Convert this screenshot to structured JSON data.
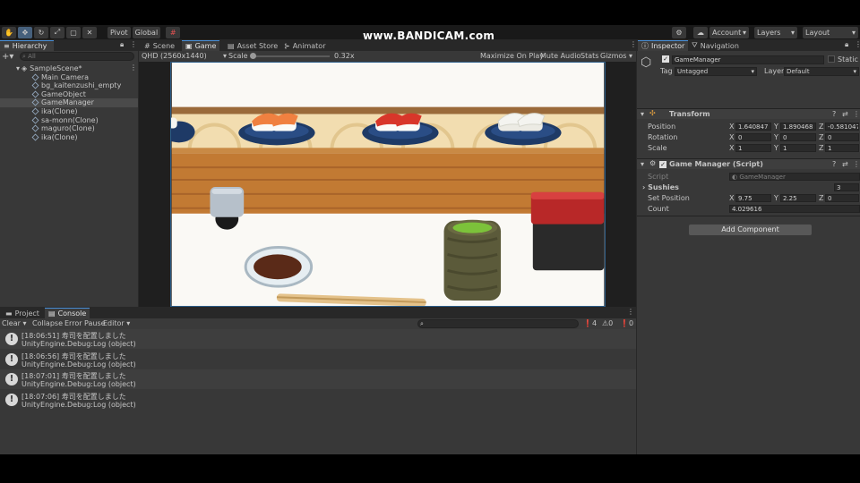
{
  "watermark": "www.BANDICAM.com",
  "toolbar": {
    "tools": [
      "hand-icon",
      "move-icon",
      "rotate-icon",
      "scale-icon",
      "rect-icon",
      "transform-icon"
    ],
    "pivot": "Pivot",
    "global": "Global",
    "account": "Account",
    "layers": "Layers",
    "layout": "Layout"
  },
  "hierarchy": {
    "tab": "Hierarchy",
    "search_placeholder": "All",
    "scene": "SampleScene*",
    "items": [
      "Main Camera",
      "bg_kaitenzushi_empty",
      "GameObject",
      "GameManager",
      "ika(Clone)",
      "sa-monn(Clone)",
      "maguro(Clone)",
      "ika(Clone)"
    ],
    "selected_index": 3
  },
  "center_tabs": {
    "scene": "Scene",
    "game": "Game",
    "asset_store": "Asset Store",
    "animator": "Animator"
  },
  "game_bar": {
    "resolution": "QHD (2560x1440)",
    "scale_label": "Scale",
    "scale_value": "0.32x",
    "maximize": "Maximize On Play",
    "mute": "Mute Audio",
    "stats": "Stats",
    "gizmos": "Gizmos"
  },
  "inspector": {
    "tab": "Inspector",
    "nav_tab": "Navigation",
    "object_name": "GameManager",
    "static": "Static",
    "tag_label": "Tag",
    "tag_value": "Untagged",
    "layer_label": "Layer",
    "layer_value": "Default",
    "transform": {
      "title": "Transform",
      "position_label": "Position",
      "position": [
        "1.640847",
        "1.890468",
        "-0.581047"
      ],
      "rotation_label": "Rotation",
      "rotation": [
        "0",
        "0",
        "0"
      ],
      "scale_label": "Scale",
      "scale": [
        "1",
        "1",
        "1"
      ]
    },
    "script_comp": {
      "title": "Game Manager (Script)",
      "script_label": "Script",
      "script_value": "GameManager",
      "sushies_label": "Sushies",
      "sushies_value": "3",
      "setpos_label": "Set Position",
      "setpos": [
        "9.75",
        "2.25",
        "0"
      ],
      "count_label": "Count",
      "count_value": "4.029616"
    },
    "add_component": "Add Component",
    "axes": [
      "X",
      "Y",
      "Z"
    ]
  },
  "bottom": {
    "project_tab": "Project",
    "console_tab": "Console",
    "clear": "Clear",
    "collapse": "Collapse",
    "error_pause": "Error Pause",
    "editor": "Editor",
    "counts": [
      "4",
      "0",
      "0"
    ],
    "logs": [
      {
        "time": "[18:06:51] 寿司を配置しました",
        "sub": "UnityEngine.Debug:Log (object)"
      },
      {
        "time": "[18:06:56] 寿司を配置しました",
        "sub": "UnityEngine.Debug:Log (object)"
      },
      {
        "time": "[18:07:01] 寿司を配置しました",
        "sub": "UnityEngine.Debug:Log (object)"
      },
      {
        "time": "[18:07:06] 寿司を配置しました",
        "sub": "UnityEngine.Debug:Log (object)"
      }
    ]
  },
  "colors": {
    "accent": "#4a90d9",
    "selection": "#2c5d87",
    "salmon": "#f08040",
    "tuna": "#d8362a",
    "squid": "#f4f4f0"
  }
}
